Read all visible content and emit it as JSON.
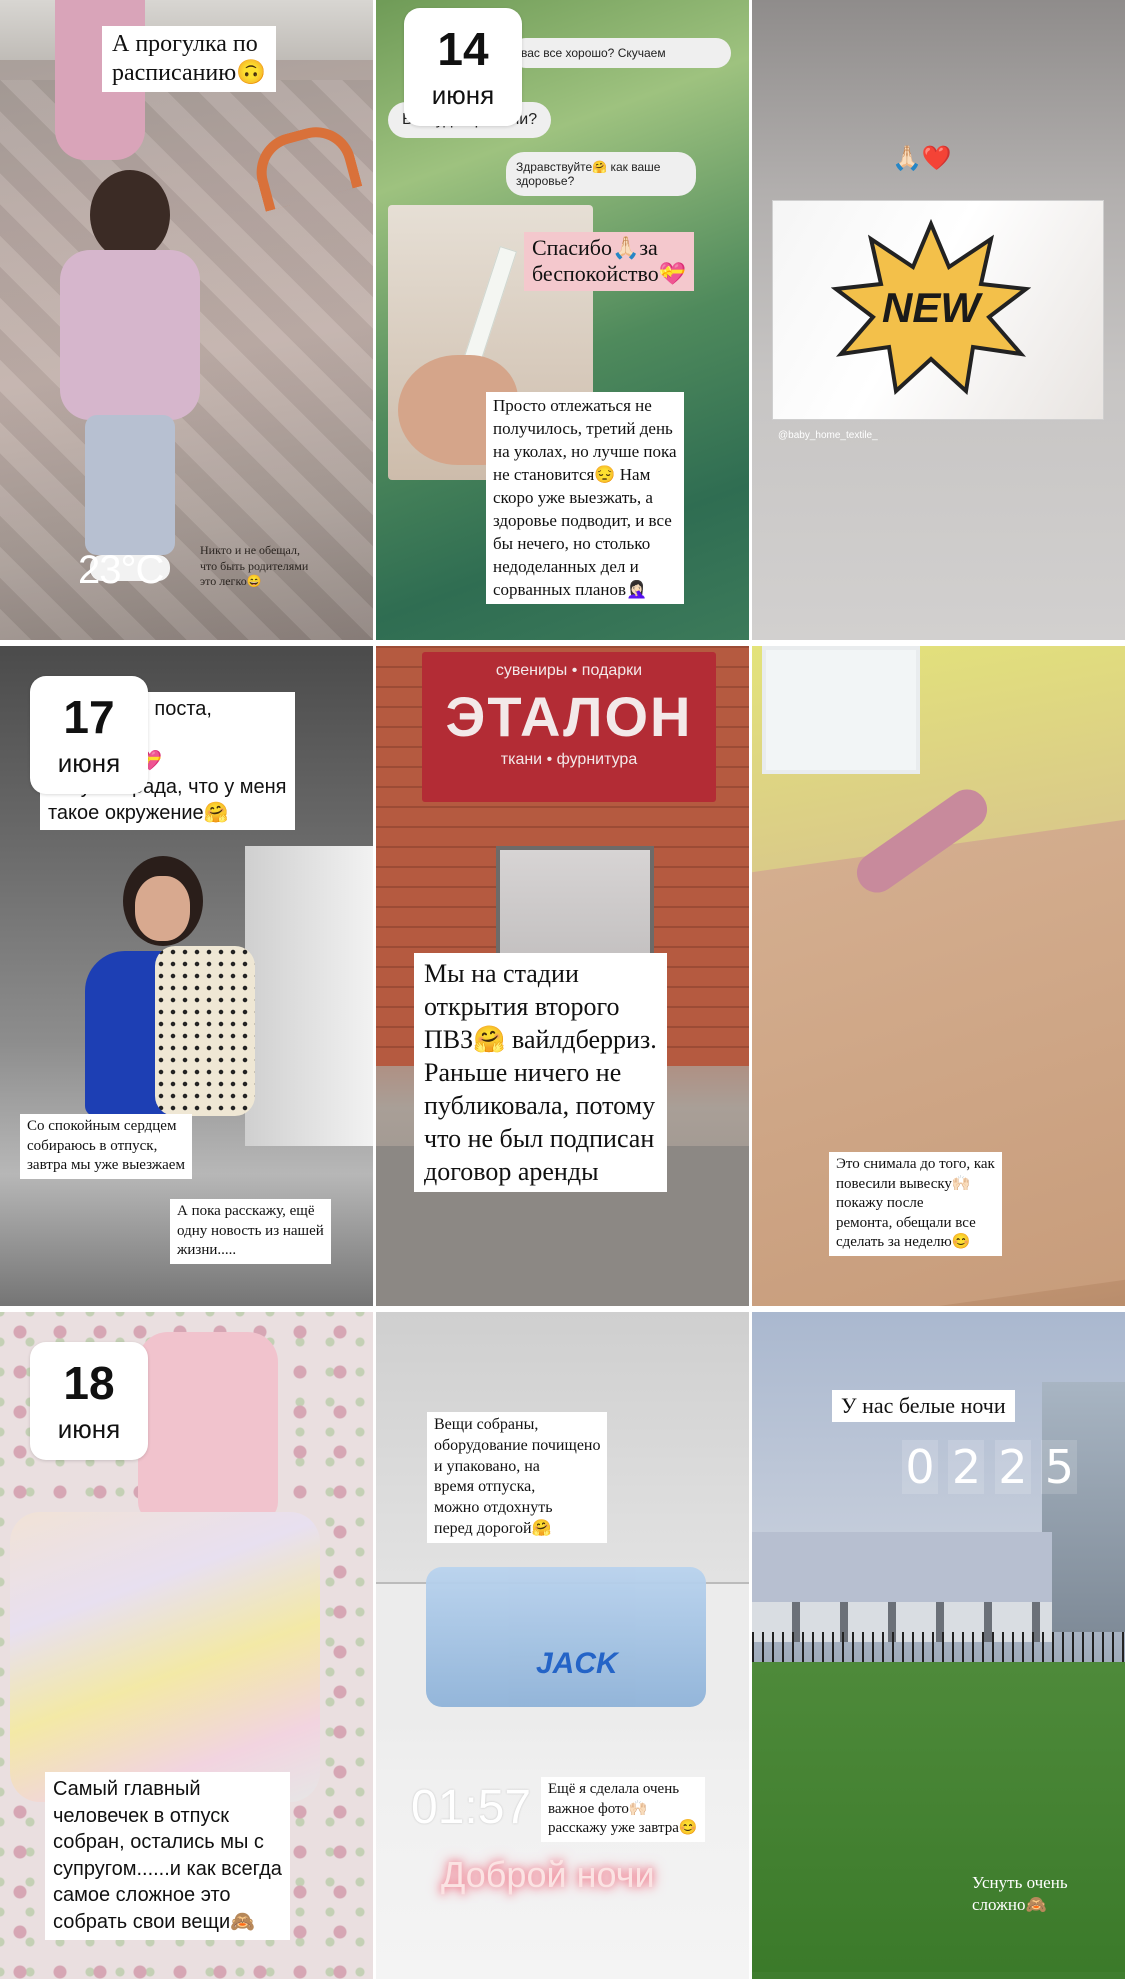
{
  "tiles": [
    {
      "caption": "А прогулка по\nрасписанию🙃",
      "temperature": "23°C",
      "note": "Никто и не обещал,\nчто быть родителями\nэто легко😄"
    },
    {
      "date_day": "14",
      "date_month": "июня",
      "chat": {
        "msg1": "вас все хорошо? Скучаем",
        "msg2": "Вы куда пропали?",
        "msg3": "Здравствуйте🤗 как ваше\nздоровье?"
      },
      "caption_pink": "Спасибо🙏🏻за\nбеспокойство💝",
      "caption": "Просто отлежаться не\nполучилось, третий день\nна уколах, но лучше пока\nне становится😔 Нам\nскоро уже выезжать, а\nздоровье подводит, и все\nбы нечего, но столько\nнедоделанных дел и\nсорванных планов🤦🏻‍♀️"
    },
    {
      "emoji": "🙏🏻❤️",
      "sticker_word": "NEW",
      "mention": "@baby_home_textile_"
    },
    {
      "date_day": "17",
      "date_month": "июня",
      "caption": "...следнего поста,\n...такую\n...у от вас💝\nБезумно рада, что у меня\nтакое окружение🤗",
      "caption_2": "Со спокойным сердцем\nсобираюсь в отпуск,\nзавтра мы уже выезжаем",
      "caption_3": "А пока расскажу, ещё\nодну новость из нашей\nжизни....."
    },
    {
      "sign_top": "сувениры • подарки",
      "sign_main": "ЭТАЛОН",
      "sign_bottom": "ткани • фурнитура",
      "caption": "Мы на стадии\nоткрытия второго\nПВЗ🤗 вайлдберриз.\nРаньше ничего не\nпубликовала, потому\nчто не был подписан\nдоговор аренды"
    },
    {
      "caption": "Это снимала до того, как\nповесили вывеску🙌🏻\nпокажу после\nремонта, обещали все\nсделать за неделю😊"
    },
    {
      "date_day": "18",
      "date_month": "июня",
      "caption": "Самый главный\nчеловечек в отпуск\nсобран, остались мы с\nсупругом......и как всегда\nсамое сложное это\nсобрать свои вещи🙈"
    },
    {
      "caption": "Вещи собраны,\nоборудование почищено\nи упаковано, на\nвремя отпуска,\nможно отдохнуть\nперед дорогой🤗",
      "brand": "JACK",
      "time": "01:57",
      "caption_2": "Ещё я сделала очень\nважное фото🙌🏻\nрасскажу уже завтра😊",
      "good_night": "Доброй ночи"
    },
    {
      "caption": "У нас белые ночи",
      "clock": [
        "0",
        "2",
        "2",
        "5"
      ],
      "note": "Уснуть очень\nсложно🙈"
    }
  ]
}
